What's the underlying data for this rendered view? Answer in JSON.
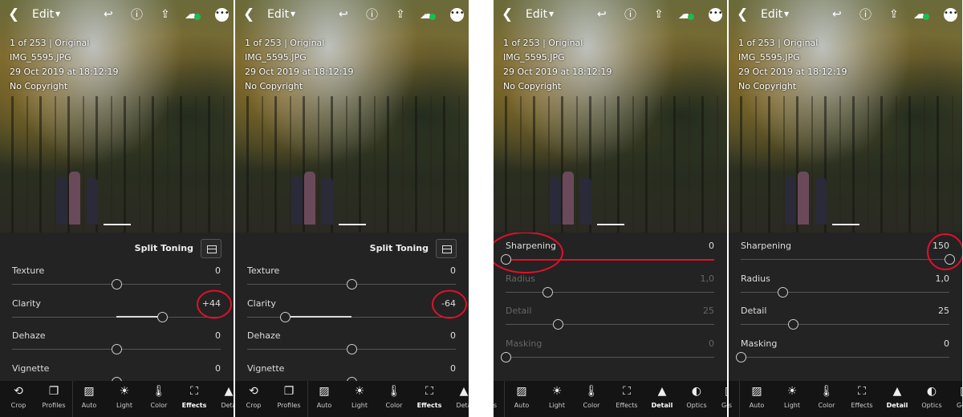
{
  "colors": {
    "annotation": "#e0102a",
    "cloud_sync": "#1db954",
    "background": "#1e1e1e"
  },
  "header": {
    "back_icon": "chevron-left",
    "title": "Edit",
    "undo_icon": "undo",
    "help_icon": "help-circle",
    "share_icon": "share",
    "cloud_icon": "cloud-synced",
    "more_icon": "more-dots"
  },
  "info": {
    "position": "1 of 253 | Original",
    "filename": "IMG_5595.JPG",
    "date": "29 Oct 2019 at 18:12:19",
    "copyright": "No Copyright"
  },
  "panels": [
    {
      "section": "Split Toning",
      "active_tool": "Effects",
      "sliders": [
        {
          "label": "Texture",
          "value": "0",
          "position": 0,
          "range": [
            -100,
            100
          ]
        },
        {
          "label": "Clarity",
          "value": "+44",
          "position": 44,
          "range": [
            -100,
            100
          ],
          "annotated": true
        },
        {
          "label": "Dehaze",
          "value": "0",
          "position": 0,
          "range": [
            -100,
            100
          ]
        },
        {
          "label": "Vignette",
          "value": "0",
          "position": 0,
          "range": [
            -100,
            100
          ]
        }
      ]
    },
    {
      "section": "Split Toning",
      "active_tool": "Effects",
      "sliders": [
        {
          "label": "Texture",
          "value": "0",
          "position": 0,
          "range": [
            -100,
            100
          ]
        },
        {
          "label": "Clarity",
          "value": "-64",
          "position": -64,
          "range": [
            -100,
            100
          ],
          "annotated": true
        },
        {
          "label": "Dehaze",
          "value": "0",
          "position": 0,
          "range": [
            -100,
            100
          ]
        },
        {
          "label": "Vignette",
          "value": "0",
          "position": 0,
          "range": [
            -100,
            100
          ]
        }
      ]
    },
    {
      "section": "",
      "active_tool": "Detail",
      "sliders": [
        {
          "label": "Sharpening",
          "value": "0",
          "position": 0,
          "range": [
            0,
            150
          ],
          "annotated": true
        },
        {
          "label": "Radius",
          "value": "1,0",
          "position": 1.0,
          "range": [
            0.5,
            3.0
          ],
          "disabled": true
        },
        {
          "label": "Detail",
          "value": "25",
          "position": 25,
          "range": [
            0,
            100
          ],
          "disabled": true
        },
        {
          "label": "Masking",
          "value": "0",
          "position": 0,
          "range": [
            0,
            100
          ],
          "disabled": true
        }
      ]
    },
    {
      "section": "",
      "active_tool": "Detail",
      "sliders": [
        {
          "label": "Sharpening",
          "value": "150",
          "position": 150,
          "range": [
            0,
            150
          ],
          "annotated": true
        },
        {
          "label": "Radius",
          "value": "1,0",
          "position": 1.0,
          "range": [
            0.5,
            3.0
          ]
        },
        {
          "label": "Detail",
          "value": "25",
          "position": 25,
          "range": [
            0,
            100
          ]
        },
        {
          "label": "Masking",
          "value": "0",
          "position": 0,
          "range": [
            0,
            100
          ]
        }
      ]
    }
  ],
  "toolbar_a": [
    {
      "label": "Crop",
      "icon": "crop"
    },
    {
      "label": "Profiles",
      "icon": "profiles"
    },
    {
      "label": "Auto",
      "icon": "auto"
    },
    {
      "label": "Light",
      "icon": "sun"
    },
    {
      "label": "Color",
      "icon": "thermometer"
    },
    {
      "label": "Effects",
      "icon": "effects"
    },
    {
      "label": "Deta",
      "icon": "detail-triangle"
    }
  ],
  "toolbar_b": [
    {
      "label": "s",
      "icon": ""
    },
    {
      "label": "Auto",
      "icon": "auto"
    },
    {
      "label": "Light",
      "icon": "sun"
    },
    {
      "label": "Color",
      "icon": "thermometer"
    },
    {
      "label": "Effects",
      "icon": "effects"
    },
    {
      "label": "Detail",
      "icon": "detail-triangle"
    },
    {
      "label": "Optics",
      "icon": "optics"
    },
    {
      "label": "Geo",
      "icon": "geometry"
    }
  ]
}
